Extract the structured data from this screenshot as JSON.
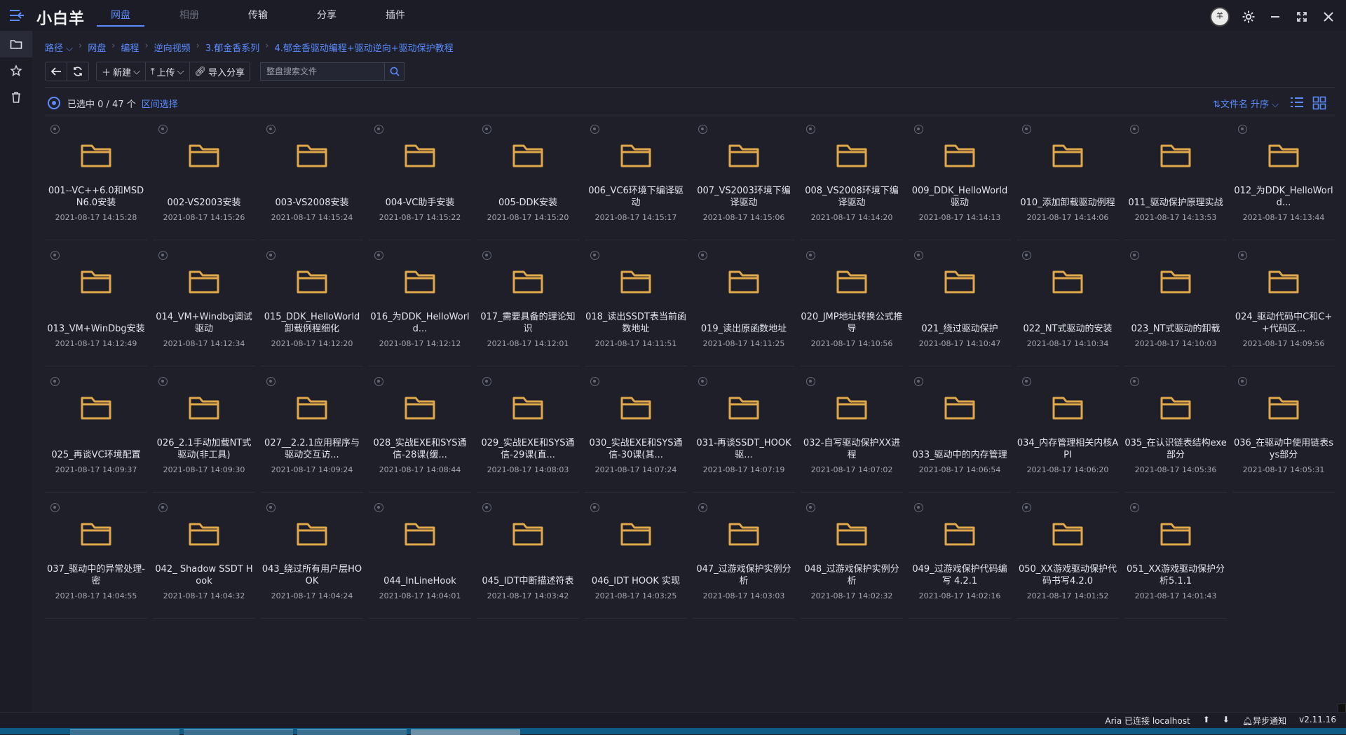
{
  "app": {
    "title": "小白羊",
    "nav": [
      {
        "label": "网盘",
        "state": "active"
      },
      {
        "label": "相册",
        "state": "disabled"
      },
      {
        "label": "传输",
        "state": "normal"
      },
      {
        "label": "分享",
        "state": "normal"
      },
      {
        "label": "插件",
        "state": "normal"
      }
    ]
  },
  "breadcrumb": [
    "路径 ⌵",
    "网盘",
    "编程",
    "逆向视频",
    "3.郁金香系列",
    "4.郁金香驱动编程+驱动逆向+驱动保护教程"
  ],
  "toolbar": {
    "new_label": "新建",
    "upload_label": "上传",
    "import_label": "导入分享",
    "search_placeholder": "整盘搜索文件"
  },
  "selection": {
    "text": "已选中 0 / 47 个",
    "range_label": "区间选择",
    "sort_label": "文件名 升序"
  },
  "files": [
    {
      "name": "001--VC++6.0和MSDN6.0安装",
      "date": "2021-08-17 14:15:28"
    },
    {
      "name": "002-VS2003安装",
      "date": "2021-08-17 14:15:26"
    },
    {
      "name": "003-VS2008安装",
      "date": "2021-08-17 14:15:24"
    },
    {
      "name": "004-VC助手安装",
      "date": "2021-08-17 14:15:22"
    },
    {
      "name": "005-DDK安装",
      "date": "2021-08-17 14:15:20"
    },
    {
      "name": "006_VC6环境下编译驱动",
      "date": "2021-08-17 14:15:17"
    },
    {
      "name": "007_VS2003环境下编译驱动",
      "date": "2021-08-17 14:15:06"
    },
    {
      "name": "008_VS2008环境下编译驱动",
      "date": "2021-08-17 14:14:20"
    },
    {
      "name": "009_DDK_HelloWorld驱动",
      "date": "2021-08-17 14:14:13"
    },
    {
      "name": "010_添加卸载驱动例程",
      "date": "2021-08-17 14:14:06"
    },
    {
      "name": "011_驱动保护原理实战",
      "date": "2021-08-17 14:13:53"
    },
    {
      "name": "012_为DDK_HelloWorld...",
      "date": "2021-08-17 14:13:44"
    },
    {
      "name": "013_VM+WinDbg安装",
      "date": "2021-08-17 14:12:49"
    },
    {
      "name": "014_VM+Windbg调试驱动",
      "date": "2021-08-17 14:12:34"
    },
    {
      "name": "015_DDK_HelloWorld卸载例程细化",
      "date": "2021-08-17 14:12:20"
    },
    {
      "name": "016_为DDK_HelloWorld...",
      "date": "2021-08-17 14:12:12"
    },
    {
      "name": "017_需要具备的理论知识",
      "date": "2021-08-17 14:12:01"
    },
    {
      "name": "018_读出SSDT表当前函数地址",
      "date": "2021-08-17 14:11:51"
    },
    {
      "name": "019_读出原函数地址",
      "date": "2021-08-17 14:11:25"
    },
    {
      "name": "020_JMP地址转换公式推导",
      "date": "2021-08-17 14:10:56"
    },
    {
      "name": "021_绕过驱动保护",
      "date": "2021-08-17 14:10:47"
    },
    {
      "name": "022_NT式驱动的安装",
      "date": "2021-08-17 14:10:34"
    },
    {
      "name": "023_NT式驱动的卸载",
      "date": "2021-08-17 14:10:03"
    },
    {
      "name": "024_驱动代码中C和C++代码区...",
      "date": "2021-08-17 14:09:56"
    },
    {
      "name": "025_再谈VC环境配置",
      "date": "2021-08-17 14:09:37"
    },
    {
      "name": "026_2.1手动加载NT式驱动(非工具)",
      "date": "2021-08-17 14:09:30"
    },
    {
      "name": "027__2.2.1应用程序与驱动交互访...",
      "date": "2021-08-17 14:09:24"
    },
    {
      "name": "028_实战EXE和SYS通信-28课(缓...",
      "date": "2021-08-17 14:08:44"
    },
    {
      "name": "029_实战EXE和SYS通信-29课(直...",
      "date": "2021-08-17 14:08:03"
    },
    {
      "name": "030_实战EXE和SYS通信-30课(其...",
      "date": "2021-08-17 14:07:24"
    },
    {
      "name": "031-再谈SSDT_HOOK驱...",
      "date": "2021-08-17 14:07:19"
    },
    {
      "name": "032-自写驱动保护XX进程",
      "date": "2021-08-17 14:07:02"
    },
    {
      "name": "033_驱动中的内存管理",
      "date": "2021-08-17 14:06:54"
    },
    {
      "name": "034_内存管理相关内核API",
      "date": "2021-08-17 14:06:20"
    },
    {
      "name": "035_在认识链表结构exe部分",
      "date": "2021-08-17 14:05:36"
    },
    {
      "name": "036_在驱动中使用链表sys部分",
      "date": "2021-08-17 14:05:31"
    },
    {
      "name": "037_驱动中的异常处理-密",
      "date": "2021-08-17 14:04:55"
    },
    {
      "name": "042_ Shadow SSDT Hook",
      "date": "2021-08-17 14:04:32"
    },
    {
      "name": "043_绕过所有用户层HOOK",
      "date": "2021-08-17 14:04:24"
    },
    {
      "name": "044_InLineHook",
      "date": "2021-08-17 14:04:01"
    },
    {
      "name": "045_IDT中断描述符表",
      "date": "2021-08-17 14:03:42"
    },
    {
      "name": "046_IDT HOOK 实现",
      "date": "2021-08-17 14:03:25"
    },
    {
      "name": "047_过游戏保护实例分析",
      "date": "2021-08-17 14:03:03"
    },
    {
      "name": "048_过游戏保护实例分析",
      "date": "2021-08-17 14:02:32"
    },
    {
      "name": "049_过游戏保护代码编写 4.2.1",
      "date": "2021-08-17 14:02:16"
    },
    {
      "name": "050_XX游戏驱动保护代码书写4.2.0",
      "date": "2021-08-17 14:01:52"
    },
    {
      "name": "051_XX游戏驱动保护分析5.1.1",
      "date": "2021-08-17 14:01:43"
    }
  ],
  "status": {
    "aria": "Aria 已连接 localhost",
    "notify": "异步通知",
    "version": "v2.11.16"
  },
  "colors": {
    "accent": "#5b8cff",
    "folder": "#e0a84a",
    "background": "#1e1f29"
  }
}
